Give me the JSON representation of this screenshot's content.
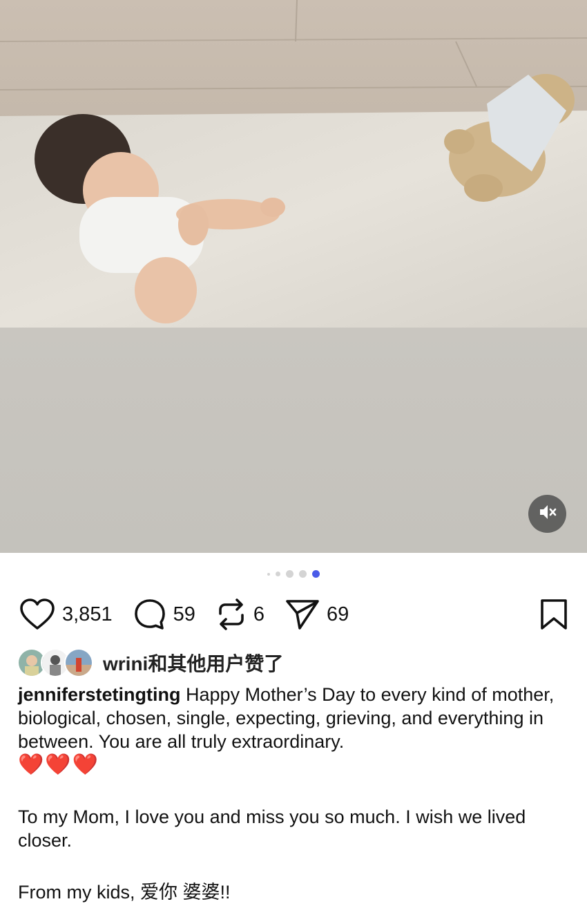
{
  "post": {
    "media_alt": "Baby sitting on a white rug looking at a teddy bear with a cloth on its head",
    "carousel": {
      "count": 5,
      "active_index": 4
    },
    "mute_button": {
      "icon": "speaker-muted-icon"
    }
  },
  "actions": {
    "likes": {
      "icon": "heart-icon",
      "count": "3,851"
    },
    "comments": {
      "icon": "comment-icon",
      "count": "59"
    },
    "reposts": {
      "icon": "repost-icon",
      "count": "6"
    },
    "shares": {
      "icon": "send-icon",
      "count": "69"
    },
    "save": {
      "icon": "bookmark-icon"
    }
  },
  "liked_by": {
    "text": "wrini和其他用户赞了",
    "avatars": [
      "avatar-1",
      "avatar-2",
      "avatar-3"
    ]
  },
  "caption": {
    "username": "jenniferstetingting",
    "line1": "Happy Mother’s Day to every kind of mother, biological, chosen, single, expecting, grieving, and everything in between. You are all truly extraordinary.",
    "hearts": "❤️❤️❤️",
    "line2": "To my Mom, I love you and miss you so much. I wish we lived closer.",
    "line3": "From my kids, 爱你 婆婆!!"
  },
  "colors": {
    "accent_dot": "#4a5be8",
    "heart_red": "#c8161d"
  }
}
